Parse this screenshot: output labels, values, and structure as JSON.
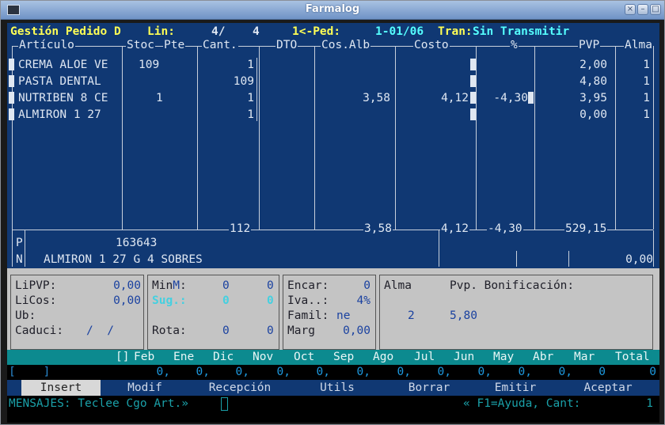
{
  "window": {
    "title": "Farmalog",
    "buttons": [
      "×",
      "–",
      "□"
    ]
  },
  "header": {
    "title": "Gestión Pedido D",
    "lin_label": "Lin:",
    "lin_current": "4/",
    "lin_total": "4",
    "ped_label": "1<-Ped:",
    "ped_value": "1-01/06",
    "tran_label": "Tran:",
    "tran_value": "Sin Transmitir"
  },
  "table": {
    "columns": [
      "Artículo",
      "Stoc",
      "Pte",
      "Cant.",
      "DTO",
      "Cos.Alb",
      "Costo",
      "%",
      "PVP",
      "Alma"
    ],
    "rows": [
      {
        "articulo": "CREMA ALOE VE",
        "stoc": "109",
        "pte": "",
        "cant": "1",
        "dto": "",
        "cos_alb": "",
        "costo": "",
        "pct": "",
        "pvp": "2,00",
        "alma": "1"
      },
      {
        "articulo": "PASTA DENTAL",
        "stoc": "",
        "pte": "",
        "cant": "109",
        "dto": "",
        "cos_alb": "",
        "costo": "",
        "pct": "",
        "pvp": "4,80",
        "alma": "1"
      },
      {
        "articulo": "NUTRIBEN 8 CE",
        "stoc": "1",
        "pte": "",
        "cant": "1",
        "dto": "",
        "cos_alb": "3,58",
        "costo": "4,12",
        "pct": "-4,30",
        "pvp": "3,95",
        "alma": "1"
      },
      {
        "articulo": "ALMIRON 1 27",
        "stoc": "",
        "pte": "",
        "cant": "1",
        "dto": "",
        "cos_alb": "",
        "costo": "",
        "pct": "",
        "pvp": "0,00",
        "alma": "1"
      }
    ],
    "totals": {
      "cant": "112",
      "cos_alb": "3,58",
      "costo": "4,12",
      "pct": "-4,30",
      "pvp": "529,15"
    }
  },
  "detail": {
    "p_label": "P",
    "p_value": "163643",
    "n_label": "N",
    "n_value": "ALMIRON 1 27 G 4 SOBRES",
    "amount": "0,00"
  },
  "info": {
    "lipvp_label": "LiPVP:",
    "lipvp_value": "0,00",
    "licos_label": "LiCos:",
    "licos_value": "0,00",
    "ub_label": "Ub:",
    "caduci_label": "Caduci:",
    "caduci_value": "/  /",
    "minm_label_a": "Min",
    "minm_label_b": "M",
    "minm_label_c": ":",
    "minm_v1": "0",
    "minm_v2": "0",
    "sug_label": "Sug.:",
    "sug_v1": "0",
    "sug_v2": "0",
    "rota_label": "Rota:",
    "rota_v1": "0",
    "rota_v2": "0",
    "encar_label": "Encar:",
    "encar_value": "0",
    "iva_label": "Iva..:",
    "iva_value": "4%",
    "famil_label": "Famil:",
    "famil_value": "ne",
    "marg_label": "Marg",
    "marg_value": "0,00",
    "alma_label": "Alma",
    "pvp_bonif_label": "Pvp. Bonificación:",
    "alma_value": "2",
    "pvp_value": "5,80"
  },
  "months": {
    "bracket": "[]",
    "labels": [
      "Feb",
      "Ene",
      "Dic",
      "Nov",
      "Oct",
      "Sep",
      "Ago",
      "Jul",
      "Jun",
      "May",
      "Abr",
      "Mar",
      "Total"
    ],
    "input_bracket": "[    ]",
    "values": [
      "0,",
      "0,",
      "0,",
      "0,",
      "0,",
      "0,",
      "0,",
      "0,",
      "0,",
      "0,",
      "0,",
      "0",
      "0"
    ]
  },
  "menu": {
    "items": [
      "Insert",
      "Modif",
      "Recepción",
      "Utils",
      "Borrar",
      "Emitir",
      "Aceptar"
    ],
    "active_index": 0
  },
  "status": {
    "message": "MENSAJES: Teclee Cgo Art.»",
    "help": "« F1=Ayuda, Cant:",
    "cant_value": "1"
  },
  "colors": {
    "navy": "#103873",
    "yellow": "#ffff55",
    "cyan": "#55ffff",
    "teal": "#0c8a8f",
    "gray": "#c4c4c4"
  }
}
